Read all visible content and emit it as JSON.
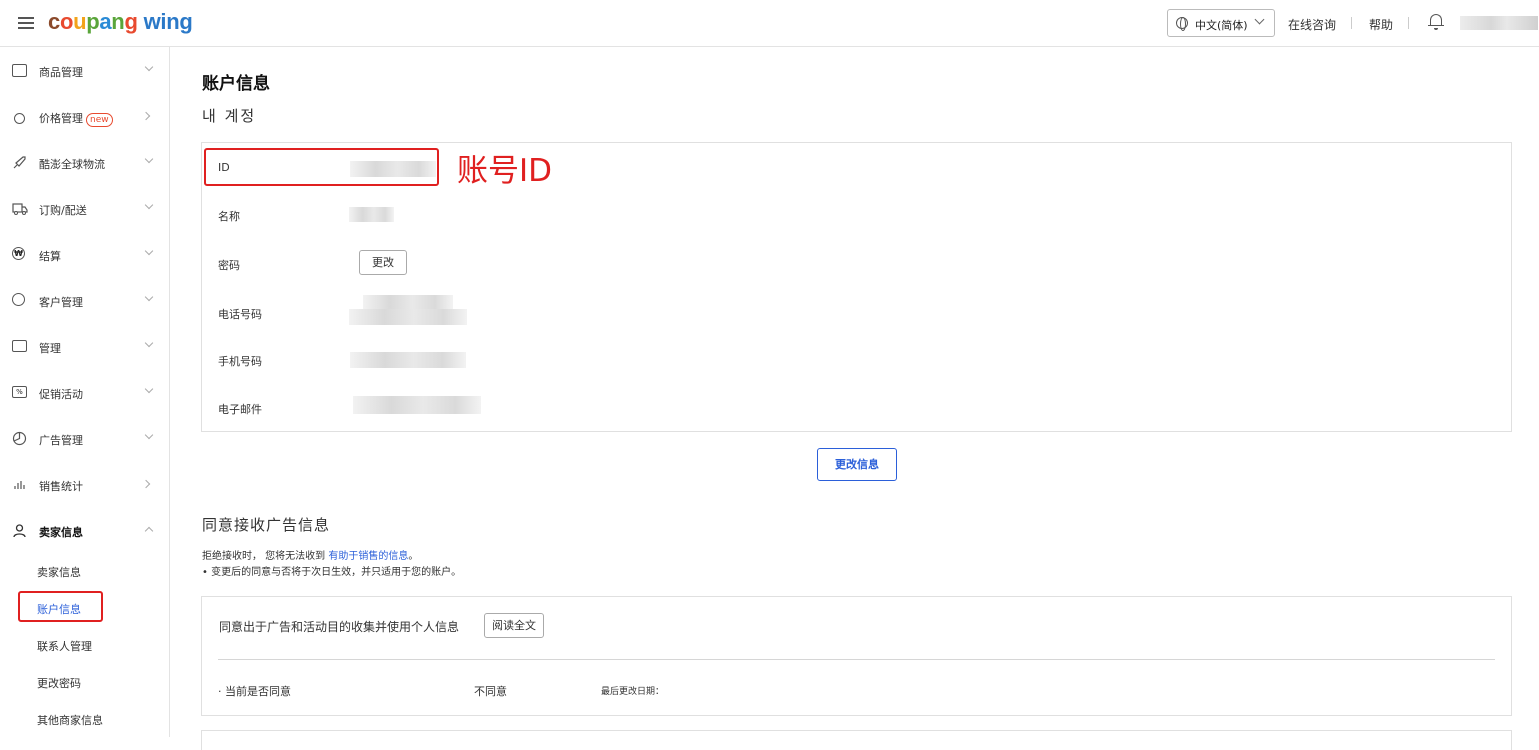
{
  "header": {
    "logo": {
      "letters": [
        "c",
        "o",
        "u",
        "p",
        "a",
        "n",
        "g"
      ],
      "suffix": "wing"
    },
    "language": "中文(简体)",
    "links": [
      "在线咨询",
      "帮助"
    ],
    "icons": [
      "menu-icon",
      "globe-icon",
      "bell-icon"
    ]
  },
  "sidebar": {
    "items": [
      {
        "label": "商品管理",
        "icon": "box-icon",
        "arrow": "down"
      },
      {
        "label": "价格管理",
        "icon": "medal-icon",
        "badge": "new",
        "arrow": "right"
      },
      {
        "label": "酷澎全球物流",
        "icon": "rocket-icon",
        "arrow": "down"
      },
      {
        "label": "订购/配送",
        "icon": "truck-icon",
        "arrow": "down"
      },
      {
        "label": "结算",
        "icon": "won-icon",
        "arrow": "down"
      },
      {
        "label": "客户管理",
        "icon": "smile-icon",
        "arrow": "down"
      },
      {
        "label": "管理",
        "icon": "store-icon",
        "arrow": "down"
      },
      {
        "label": "促销活动",
        "icon": "coupon-icon",
        "arrow": "down"
      },
      {
        "label": "广告管理",
        "icon": "pie-icon",
        "arrow": "down"
      },
      {
        "label": "销售统计",
        "icon": "bars-icon",
        "arrow": "right"
      },
      {
        "label": "卖家信息",
        "icon": "person-icon",
        "arrow": "up",
        "expanded": true
      }
    ],
    "subitems": [
      {
        "label": "卖家信息",
        "active": false
      },
      {
        "label": "账户信息",
        "active": true
      },
      {
        "label": "联系人管理",
        "active": false
      },
      {
        "label": "更改密码",
        "active": false
      },
      {
        "label": "其他商家信息",
        "active": false
      }
    ]
  },
  "main": {
    "title": "账户信息",
    "account_section_title": "내 계정",
    "annotation": "账号ID",
    "fields": [
      {
        "label": "ID"
      },
      {
        "label": "名称"
      },
      {
        "label": "密码",
        "button": "更改"
      },
      {
        "label": "电话号码"
      },
      {
        "label": "手机号码"
      },
      {
        "label": "电子邮件"
      }
    ],
    "update_button": "更改信息",
    "ad_section": {
      "title": "同意接收广告信息",
      "note_prefix": "拒绝接收时， 您将无法收到 ",
      "note_link": "有助于销售的信息",
      "note_suffix": "。",
      "bullet": "• 变更后的同意与否将于次日生效，并只适用于您的账户。",
      "consent_label": "同意出于广告和活动目的收集并使用个人信息",
      "read_button": "阅读全文",
      "status_label": "· 当前是否同意",
      "status_value": "不同意",
      "last_changed_label": "最后更改日期："
    }
  }
}
